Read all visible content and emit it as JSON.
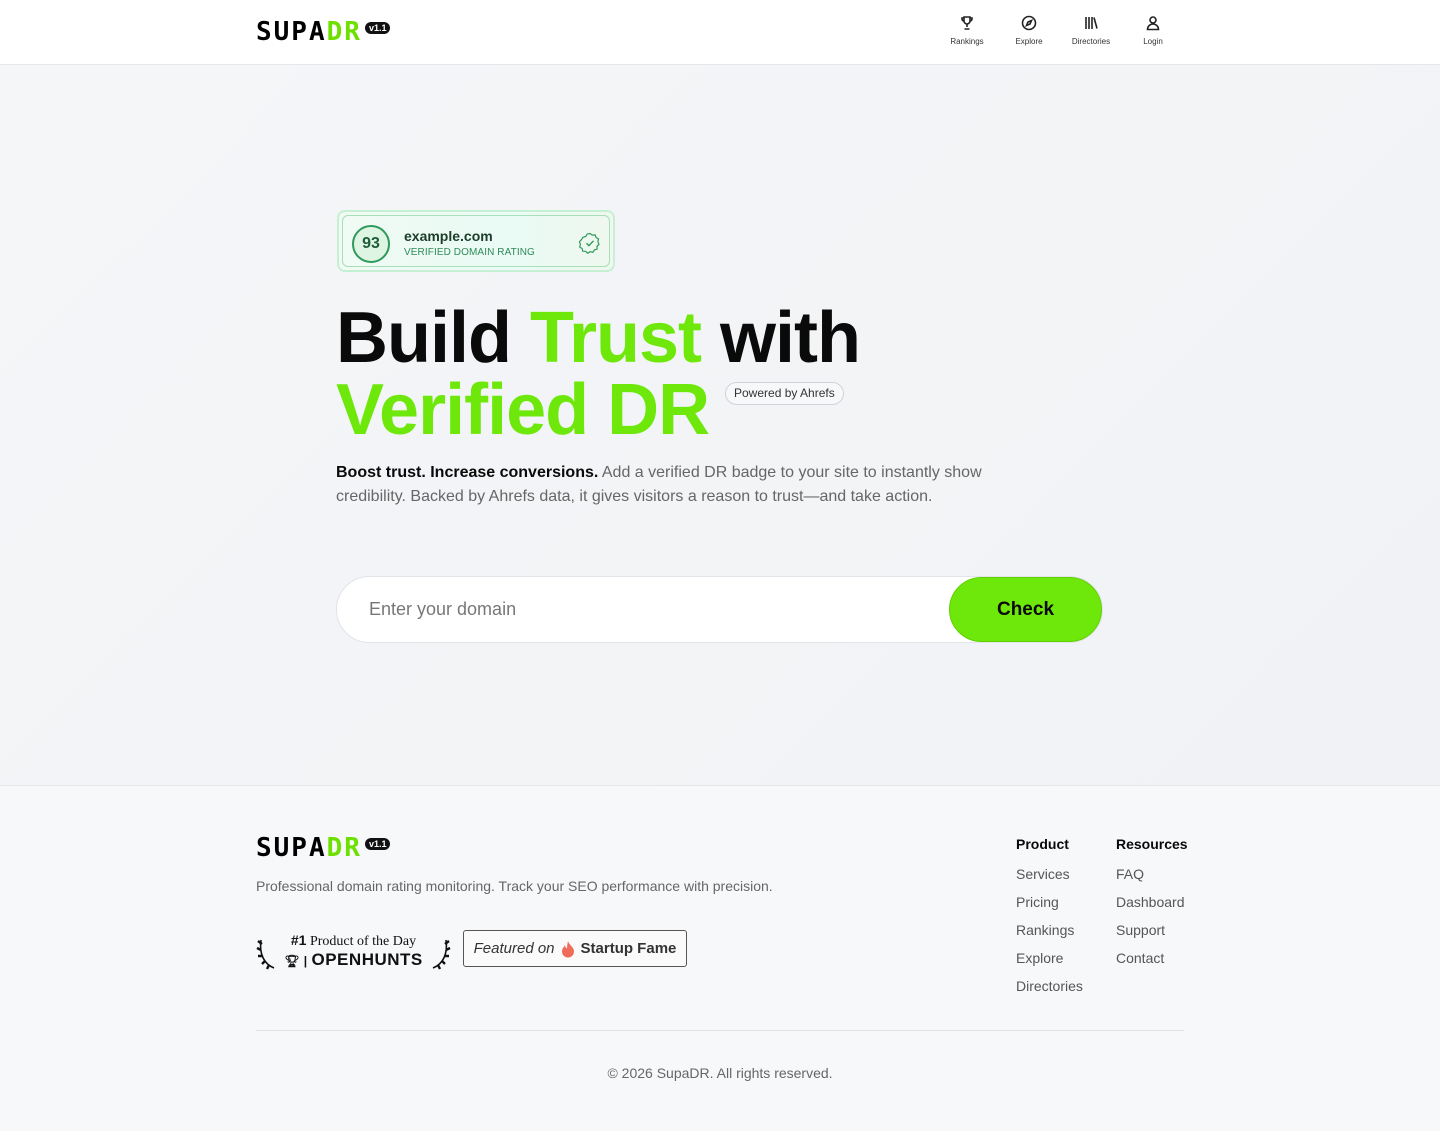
{
  "header": {
    "logo": {
      "supa": "SUPA",
      "dr": "DR",
      "version": "v1.1"
    },
    "nav": [
      {
        "label": "Rankings",
        "icon": "trophy-icon"
      },
      {
        "label": "Explore",
        "icon": "compass-icon"
      },
      {
        "label": "Directories",
        "icon": "library-icon"
      },
      {
        "label": "Login",
        "icon": "user-icon"
      }
    ]
  },
  "hero": {
    "badge": {
      "score": "93",
      "domain": "example.com",
      "subtitle": "VERIFIED DOMAIN RATING",
      "icon": "verified-check-icon"
    },
    "headline": {
      "part1": "Build ",
      "part2": "Trust",
      "part3": " with",
      "line2": "Verified DR"
    },
    "powered": "Powered by Ahrefs",
    "lead_bold": "Boost trust. Increase conversions.",
    "lead_rest": " Add a verified DR badge to your site to instantly show credibility. Backed by Ahrefs data, it gives visitors a reason to trust—and take action.",
    "search": {
      "placeholder": "Enter your domain",
      "button": "Check"
    }
  },
  "footer": {
    "logo": {
      "supa": "SUPA",
      "dr": "DR",
      "version": "v1.1"
    },
    "description": "Professional domain rating monitoring. Track your SEO performance with precision.",
    "openhunts": {
      "rank": "#1",
      "text": "Product of the Day",
      "open": "OPEN",
      "hunts": "HUNTS"
    },
    "startupfame": {
      "featured": "Featured on",
      "name": "Startup Fame"
    },
    "product": {
      "title": "Product",
      "links": [
        "Services",
        "Pricing",
        "Rankings",
        "Explore",
        "Directories"
      ]
    },
    "resources": {
      "title": "Resources",
      "links": [
        "FAQ",
        "Dashboard",
        "Support",
        "Contact"
      ]
    },
    "copyright": "© 2026 SupaDR. All rights reserved."
  },
  "colors": {
    "accent": "#6ee80a",
    "badge_green": "#2f9a5b"
  }
}
